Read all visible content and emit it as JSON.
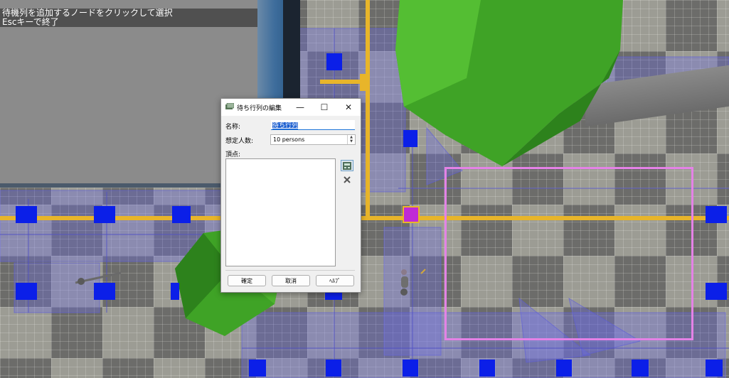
{
  "hud": {
    "line1": "待機列を追加するノードをクリックして選択",
    "line2": "Escキーで終了"
  },
  "dialog": {
    "title": "待ち行列の編集",
    "name_label": "名称:",
    "name_value": "待ち行列",
    "count_label": "想定人数:",
    "count_value": "10 persons",
    "vertex_label": "頂点:",
    "ok_label": "確定",
    "cancel_label": "取消",
    "help_label": "ﾍﾙﾌﾟ",
    "minimize_glyph": "—",
    "maximize_glyph": "☐",
    "close_glyph": "✕",
    "icons": {
      "app": "queue-edit-icon",
      "add_vertex": "add-vertex-icon",
      "delete_vertex": "delete-vertex-icon"
    }
  },
  "colors": {
    "node": "#0b1fe8",
    "selected_node": "#c02ad6",
    "path": "#e8b52a",
    "area_outline": "#e482e6",
    "tree": "#3fa326"
  }
}
